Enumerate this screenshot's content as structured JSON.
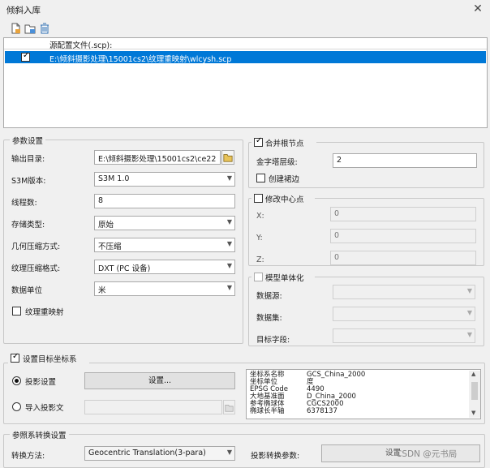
{
  "window": {
    "title": "倾斜入库",
    "close_icon": "close-icon"
  },
  "toolbar": {
    "icons": [
      "add-file-icon",
      "add-folder-icon",
      "delete-icon"
    ]
  },
  "file_list": {
    "header": "源配置文件(.scp):",
    "rows": [
      {
        "checked": true,
        "path": "E:\\倾斜摄影处理\\15001cs2\\纹理重映射\\wlcysh.scp"
      }
    ]
  },
  "params": {
    "group_title": "参数设置",
    "output_dir": {
      "label": "输出目录:",
      "value": "E:\\倾斜摄影处理\\15001cs2\\ce22"
    },
    "s3m_version": {
      "label": "S3M版本:",
      "value": "S3M 1.0"
    },
    "threads": {
      "label": "线程数:",
      "value": "8"
    },
    "storage_type": {
      "label": "存储类型:",
      "value": "原始"
    },
    "geometry_compress": {
      "label": "几何压缩方式:",
      "value": "不压缩"
    },
    "texture_compress": {
      "label": "纹理压缩格式:",
      "value": "DXT (PC 设备)"
    },
    "data_unit": {
      "label": "数据单位",
      "value": "米"
    },
    "texture_remap": {
      "label": "纹理重映射",
      "checked": false
    }
  },
  "merge": {
    "title": "合并根节点",
    "checked": true,
    "pyramid_label": "金字塔层级:",
    "pyramid_value": "2",
    "create_skirt_label": "创建裙边",
    "create_skirt_checked": false
  },
  "center": {
    "title": "修改中心点",
    "checked": false,
    "x_label": "X:",
    "x_value": "0",
    "y_label": "Y:",
    "y_value": "0",
    "z_label": "Z:",
    "z_value": "0"
  },
  "model": {
    "title": "模型单体化",
    "checked": false,
    "datasource_label": "数据源:",
    "dataset_label": "数据集:",
    "target_field_label": "目标字段:"
  },
  "target_crs": {
    "title": "设置目标坐标系",
    "checked": true,
    "projection_setting_label": "投影设置",
    "projection_setting_selected": true,
    "settings_button": "设置...",
    "import_projection_label": "导入投影文",
    "info": [
      {
        "key": "坐标系名称",
        "value": "GCS_China_2000"
      },
      {
        "key": "坐标单位",
        "value": "度"
      },
      {
        "key": "EPSG Code",
        "value": "4490"
      },
      {
        "key": "大地基准面",
        "value": "D_China_2000"
      },
      {
        "key": "参考椭球体",
        "value": "CGCS2000"
      },
      {
        "key": "椭球长半轴",
        "value": "6378137"
      }
    ]
  },
  "transform": {
    "title": "参照系转换设置",
    "method_label": "转换方法:",
    "method_value": "Geocentric Translation(3-para)",
    "params_label": "投影转换参数:",
    "params_button": "设置"
  },
  "watermark": "CSDN @元书局"
}
